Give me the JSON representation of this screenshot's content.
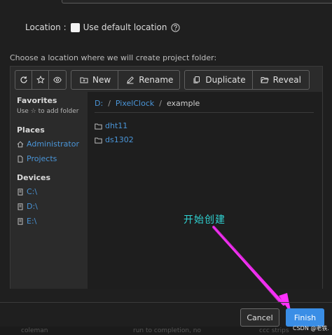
{
  "location": {
    "label": "Location :",
    "use_default_label": "Use default location"
  },
  "choose_label": "Choose a location where we will create project folder:",
  "toolbar": {
    "icon_buttons": [
      "refresh-icon",
      "star-icon",
      "eye-icon"
    ],
    "new_label": "New",
    "rename_label": "Rename",
    "duplicate_label": "Duplicate",
    "reveal_label": "Reveal"
  },
  "sidebar": {
    "favorites_heading": "Favorites",
    "favorites_hint": "Use ☆ to add folder",
    "places_heading": "Places",
    "places": [
      "Administrator",
      "Projects"
    ],
    "devices_heading": "Devices",
    "devices": [
      "C:\\",
      "D:\\",
      "E:\\"
    ]
  },
  "breadcrumb": {
    "parts": [
      "D:",
      "PixelClock",
      "example"
    ],
    "separator": "/"
  },
  "folders": [
    "dht11",
    "ds1302"
  ],
  "annotation_text": "开始创建",
  "footer": {
    "cancel_label": "Cancel",
    "finish_label": "Finish"
  },
  "background_text": {
    "left": "coleman",
    "middle": "run to completion, no",
    "right": "ccc strips"
  },
  "watermark": "CSDN @老铁.",
  "colors": {
    "link": "#4a95d8",
    "accent": "#3a8ee6",
    "annotation": "#2fd2d2",
    "arrow": "#e620e6"
  }
}
